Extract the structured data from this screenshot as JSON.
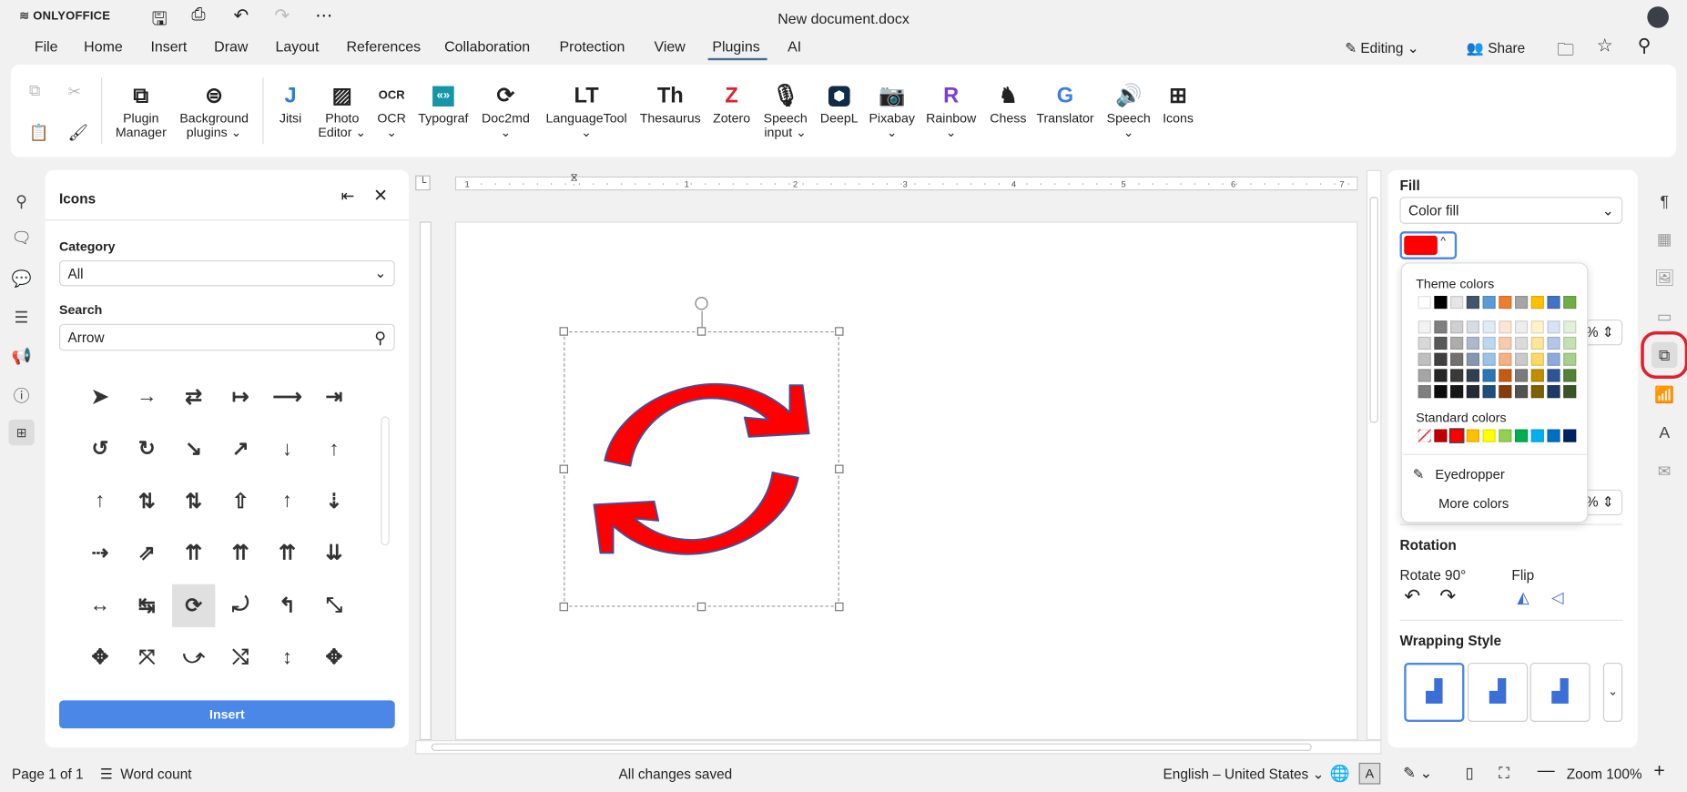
{
  "app": {
    "logo": "ONLYOFFICE",
    "title": "New document.docx"
  },
  "menu": [
    "File",
    "Home",
    "Insert",
    "Draw",
    "Layout",
    "References",
    "Collaboration",
    "Protection",
    "View",
    "Plugins",
    "AI"
  ],
  "header_right": {
    "editing": "Editing",
    "share": "Share"
  },
  "toolbar": [
    {
      "l1": "Plugin",
      "l2": "Manager",
      "icon": "⧉"
    },
    {
      "l1": "Background",
      "l2": "plugins ⌄",
      "icon": "⊜"
    },
    {
      "l1": "Jitsi",
      "l2": "",
      "icon": "J"
    },
    {
      "l1": "Photo",
      "l2": "Editor ⌄",
      "icon": "▨"
    },
    {
      "l1": "OCR",
      "l2": "⌄",
      "icon": "OCR"
    },
    {
      "l1": "Typograf",
      "l2": "",
      "icon": "«»"
    },
    {
      "l1": "Doc2md",
      "l2": "⌄",
      "icon": "⟳"
    },
    {
      "l1": "LanguageTool",
      "l2": "⌄",
      "icon": "LT"
    },
    {
      "l1": "Thesaurus",
      "l2": "",
      "icon": "Th"
    },
    {
      "l1": "Zotero",
      "l2": "",
      "icon": "Z"
    },
    {
      "l1": "Speech",
      "l2": "input ⌄",
      "icon": "🎙"
    },
    {
      "l1": "DeepL",
      "l2": "",
      "icon": "⬢"
    },
    {
      "l1": "Pixabay",
      "l2": "⌄",
      "icon": "📷"
    },
    {
      "l1": "Rainbow",
      "l2": "⌄",
      "icon": "R"
    },
    {
      "l1": "Chess",
      "l2": "",
      "icon": "♞"
    },
    {
      "l1": "Translator",
      "l2": "",
      "icon": "G"
    },
    {
      "l1": "Speech",
      "l2": "⌄",
      "icon": "🔊"
    },
    {
      "l1": "Icons",
      "l2": "",
      "icon": "⊞"
    }
  ],
  "icons_panel": {
    "title": "Icons",
    "category_label": "Category",
    "category_value": "All",
    "search_label": "Search",
    "search_value": "Arrow",
    "insert": "Insert",
    "glyphs": [
      "➤",
      "→",
      "⇄",
      "↦",
      "⟶",
      "⇥",
      "↺",
      "↻",
      "↘",
      "↗",
      "↓",
      "↑",
      "↑",
      "⇅",
      "⇅",
      "⇧",
      "↑",
      "⇣",
      "⇢",
      "⇗",
      "⇈",
      "⇈",
      "⇈",
      "⇊",
      "↔",
      "↹",
      "⟳",
      "⤾",
      "↰",
      "⤡",
      "✥",
      "⤧",
      "⤻",
      "⤭",
      "↕",
      "✥"
    ]
  },
  "fill": {
    "title": "Fill",
    "type": "Color fill",
    "color": "#ff0000",
    "theme_label": "Theme colors",
    "theme": [
      "#ffffff",
      "#000000",
      "#e7e6e6",
      "#44546a",
      "#5b9bd5",
      "#ed7d31",
      "#a5a5a5",
      "#ffc000",
      "#4472c4",
      "#70ad47"
    ],
    "shades": [
      [
        "#f2f2f2",
        "#7f7f7f",
        "#d0cece",
        "#d6dce4",
        "#deebf6",
        "#fbe5d5",
        "#ededed",
        "#fff2cc",
        "#d9e2f3",
        "#e2efd9"
      ],
      [
        "#d8d8d8",
        "#595959",
        "#aeabab",
        "#adb9ca",
        "#bdd7ee",
        "#f7cbac",
        "#dbdbdb",
        "#fee599",
        "#b4c6e7",
        "#c5e0b3"
      ],
      [
        "#bfbfbf",
        "#3f3f3f",
        "#757070",
        "#8496b0",
        "#9cc3e5",
        "#f4b083",
        "#c9c9c9",
        "#ffd965",
        "#8eaadb",
        "#a8d08d"
      ],
      [
        "#a5a5a5",
        "#262626",
        "#3a3838",
        "#323f4f",
        "#2e75b5",
        "#c55a11",
        "#7b7b7b",
        "#bf8f00",
        "#2f5496",
        "#538135"
      ],
      [
        "#7f7f7f",
        "#0c0c0c",
        "#171616",
        "#222a35",
        "#1e4e79",
        "#843c0b",
        "#525252",
        "#7f6000",
        "#1f3864",
        "#375623"
      ]
    ],
    "standard_label": "Standard colors",
    "standard": [
      "#ffffff",
      "#c00000",
      "#ff0000",
      "#ffc000",
      "#ffff00",
      "#92d050",
      "#00b050",
      "#00b0f0",
      "#0070c0",
      "#002060"
    ],
    "eyedropper": "Eyedropper",
    "more": "More colors"
  },
  "rotation": {
    "title": "Rotation",
    "rotate": "Rotate 90°",
    "flip": "Flip"
  },
  "wrapping": {
    "title": "Wrapping Style"
  },
  "status": {
    "page": "Page 1 of 1",
    "words": "Word count",
    "saved": "All changes saved",
    "lang": "English – United States",
    "zoom": "Zoom 100%"
  }
}
